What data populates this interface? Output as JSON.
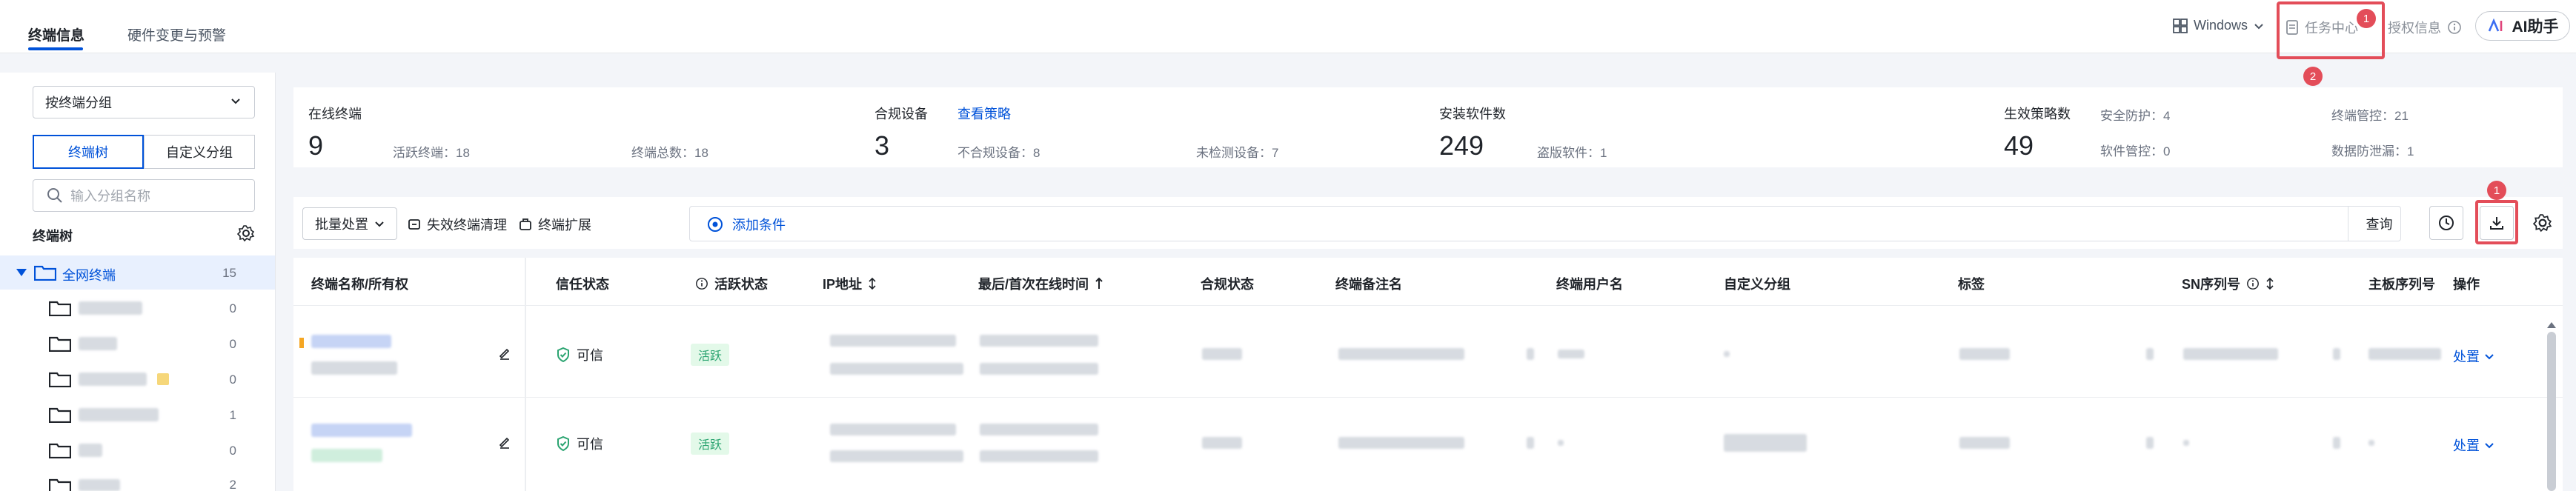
{
  "top": {
    "tabs": [
      {
        "label": "终端信息",
        "active": true
      },
      {
        "label": "硬件变更与预警",
        "active": false
      }
    ],
    "os_select": "Windows",
    "task_center": "任务中心",
    "task_badge": "1",
    "auth_info": "授权信息",
    "ai_label": "AI助手",
    "marker_2": "2"
  },
  "sidebar": {
    "group_select": "按终端分组",
    "seg_tree": "终端树",
    "seg_custom": "自定义分组",
    "search_placeholder": "输入分组名称",
    "tree_title": "终端树",
    "root": {
      "label": "全网终端",
      "count": "15"
    },
    "nodes": [
      {
        "count": "0"
      },
      {
        "count": "0"
      },
      {
        "count": "0"
      },
      {
        "count": "1"
      },
      {
        "count": "0"
      },
      {
        "count": "2"
      }
    ]
  },
  "stats": {
    "online": {
      "label": "在线终端",
      "value": "9",
      "active": "活跃终端：18",
      "total": "终端总数：18"
    },
    "compliant": {
      "label": "合规设备",
      "link": "查看策略",
      "value": "3",
      "noncompliant": "不合规设备：8",
      "unchecked": "未检测设备：7"
    },
    "software": {
      "label": "安装软件数",
      "value": "249",
      "pirated": "盗版软件：1"
    },
    "policy": {
      "label": "生效策略数",
      "value": "49",
      "security": "安全防护：4",
      "terminal_ctrl": "终端管控：21",
      "software_ctrl": "软件管控：0",
      "dlp": "数据防泄漏：1"
    }
  },
  "toolbar": {
    "batch": "批量处置",
    "invalid_clean": "失效终端清理",
    "expand": "终端扩展",
    "add_condition": "添加条件",
    "query": "查询",
    "marker_1": "1"
  },
  "table": {
    "headers": {
      "name_owner": "终端名称/所有权",
      "trust": "信任状态",
      "active": "活跃状态",
      "ip": "IP地址",
      "online_time": "最后/首次在线时间",
      "compliance": "合规状态",
      "remark": "终端备注名",
      "user": "终端用户名",
      "custom_group": "自定义分组",
      "tags": "标签",
      "sn": "SN序列号",
      "board_sn": "主板序列号",
      "ops": "操作"
    },
    "rows": [
      {
        "trust": "可信",
        "active": "活跃",
        "op": "处置"
      },
      {
        "trust": "可信",
        "active": "活跃",
        "op": "处置"
      }
    ]
  }
}
